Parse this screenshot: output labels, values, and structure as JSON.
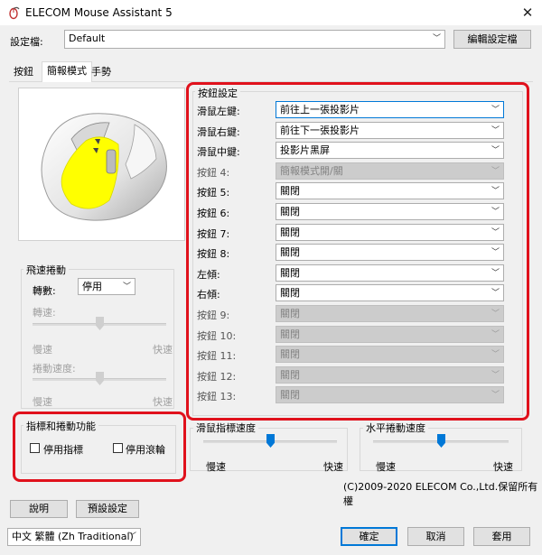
{
  "window": {
    "title": "ELECOM Mouse Assistant 5",
    "close_glyph": "✕"
  },
  "profile": {
    "label": "設定檔:",
    "value": "Default",
    "edit_button": "編輯設定檔"
  },
  "tabs": [
    {
      "label": "按鈕",
      "active": false
    },
    {
      "label": "簡報模式",
      "active": true
    },
    {
      "label": "手勢",
      "active": false
    }
  ],
  "smooth_scroll": {
    "title": "飛速捲動",
    "speed_label": "轉數:",
    "speed_value": "停用",
    "rotation_label": "轉速:",
    "slow": "慢速",
    "fast": "快速",
    "rotation_level": 0.5,
    "scroll_speed_label": "捲動速度:",
    "scroll_level": 0.5
  },
  "pointer_scroll": {
    "title": "指標和捲動功能",
    "disable_pointer": "停用指標",
    "disable_scroll": "停用滾輪"
  },
  "button_settings": {
    "title": "按鈕設定",
    "rows": [
      {
        "label": "滑鼠左鍵:",
        "value": "前往上一張投影片",
        "enabled": true,
        "focused": true
      },
      {
        "label": "滑鼠右鍵:",
        "value": "前往下一張投影片",
        "enabled": true
      },
      {
        "label": "滑鼠中鍵:",
        "value": "投影片黑屏",
        "enabled": true
      },
      {
        "label": "按鈕 4:",
        "value": "簡報模式開/關",
        "enabled": false
      },
      {
        "label": "按鈕 5:",
        "value": "關閉",
        "enabled": true
      },
      {
        "label": "按鈕 6:",
        "value": "關閉",
        "enabled": true
      },
      {
        "label": "按鈕 7:",
        "value": "關閉",
        "enabled": true
      },
      {
        "label": "按鈕 8:",
        "value": "關閉",
        "enabled": true
      },
      {
        "label": "左傾:",
        "value": "關閉",
        "enabled": true
      },
      {
        "label": "右傾:",
        "value": "關閉",
        "enabled": true
      },
      {
        "label": "按鈕 9:",
        "value": "關閉",
        "enabled": false
      },
      {
        "label": "按鈕 10:",
        "value": "關閉",
        "enabled": false
      },
      {
        "label": "按鈕 11:",
        "value": "關閉",
        "enabled": false
      },
      {
        "label": "按鈕 12:",
        "value": "關閉",
        "enabled": false
      },
      {
        "label": "按鈕 13:",
        "value": "關閉",
        "enabled": false
      }
    ]
  },
  "cursor_speed": {
    "title": "滑鼠指標速度",
    "slow": "慢速",
    "fast": "快速",
    "level": 0.5
  },
  "horizontal_scroll": {
    "title": "水平捲動速度",
    "slow": "慢速",
    "fast": "快速",
    "level": 0.5
  },
  "copyright": "(C)2009-2020 ELECOM Co.,Ltd.保留所有權",
  "footer": {
    "help": "說明",
    "defaults": "預設設定",
    "language": "中文 繁體 (Zh Traditional)",
    "ok": "確定",
    "cancel": "取消",
    "apply": "套用"
  },
  "colors": {
    "accent": "#0078d7",
    "highlight": "#e0111c",
    "mouse_area": "#ffff00"
  }
}
